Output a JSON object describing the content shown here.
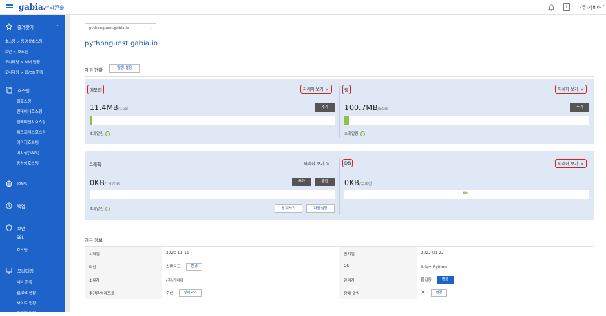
{
  "header": {
    "logo": "gabia.",
    "logo_sub": "관리콘솔",
    "user": "(주)가비아",
    "doc_icon_label": "i"
  },
  "sidebar": {
    "favorites_label": "즐겨찾기",
    "favorites": [
      "호스팅 > 동영상호스팅",
      "보안 > 호스팅",
      "모니터링 > 서버 현황",
      "모니터링 > 웹/DB 현황"
    ],
    "hosting_label": "호스팅",
    "hosting_items": [
      "웹호스팅",
      "컨테이너호스팅",
      "웹에이전시호스팅",
      "워드프레스호스팅",
      "이미지호스팅",
      "메시징(SMS)",
      "동영상호스팅"
    ],
    "dns_label": "DNS",
    "backup_label": "백업",
    "security_label": "보안",
    "security_items": [
      "SSL",
      "호스팅"
    ],
    "monitoring_label": "모니터링",
    "monitoring_items": [
      "서버 현황",
      "웹/DB 현황",
      "사이트 현황",
      "트래픽 현황"
    ]
  },
  "main": {
    "domain_select": "pythonguest.gabia.io",
    "domain_title": "pythonguest.gabia.io",
    "resource_title": "자원 현황",
    "alarm_button": "알림 설정",
    "detail_label": "자세히 보기",
    "detail_arrow": ">",
    "add_label": "추가",
    "charge_label": "충전",
    "over_label": "초과알림",
    "memory": {
      "name": "메모리",
      "used": "11.4MB",
      "total": "/1GB",
      "fill_percent": 1.1
    },
    "web": {
      "name": "웹",
      "used": "100.7MB",
      "total": "/5GB",
      "fill_percent": 2.0
    },
    "traffic": {
      "name": "트래픽",
      "used": "0KB",
      "total": "/132GB",
      "fill_percent": 0,
      "buttons": [
        "당겨쓰기",
        "자동설정"
      ]
    },
    "db": {
      "name": "DB",
      "used": "0KB",
      "total": "/무제한",
      "infinity": "∞"
    },
    "basic_title": "기본 정보",
    "basic": {
      "start_label": "시작일",
      "start": "2020-11-11",
      "expire_label": "만기일",
      "expire": "2022-01-22",
      "type_label": "타입",
      "type": "스탠다드",
      "change": "변경",
      "os_label": "OS",
      "os": "리눅스 Python",
      "owner_label": "소유자",
      "owner": "(주)가비아",
      "admin_label": "관리자",
      "admin": "홍길동",
      "report_label": "주간운영리포트",
      "report": "수신",
      "report_btn": "상세보기",
      "fault_label": "장애 알림",
      "fault": "✕"
    }
  },
  "colors": {
    "brand": "#1d63c9",
    "highlight": "#dd2222",
    "bar_fill": "#8bc34a"
  }
}
